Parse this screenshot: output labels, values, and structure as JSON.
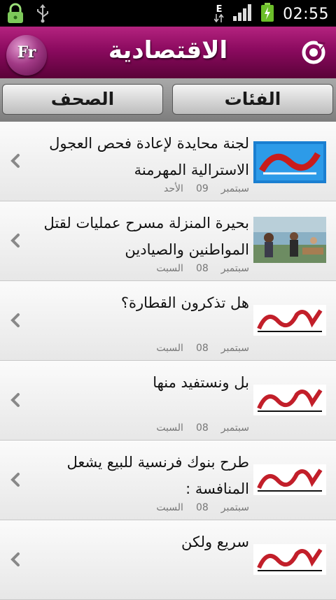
{
  "statusbar": {
    "clock": "02:55",
    "network_letter": "E",
    "icons": [
      "lock-icon",
      "usb-icon",
      "data-transfer-icon",
      "signal-icon",
      "battery-charging-icon"
    ]
  },
  "titlebar": {
    "logo_text": "Fr",
    "title": "الاقتصادية",
    "refresh_icon": "refresh-icon"
  },
  "tabs": {
    "papers": "الصحف",
    "categories": "الفئات"
  },
  "articles": [
    {
      "headline": "لجنة محايدة لإعادة فحص العجول الاسترالية المهرمنة",
      "day": "الأحد",
      "date": "09",
      "month": "سبتمبر",
      "source_icon": "akhbar-logo-icon"
    },
    {
      "headline": "بحيرة المنزلة مسرح عمليات لقتل المواطنين والصيادين",
      "day": "السبت",
      "date": "08",
      "month": "سبتمبر",
      "source_icon": "photo-thumbnail-icon"
    },
    {
      "headline": "هل تذكرون القطارة؟",
      "day": "السبت",
      "date": "08",
      "month": "سبتمبر",
      "source_icon": "ahram-logo-icon"
    },
    {
      "headline": "بل ونستفيد منها",
      "day": "السبت",
      "date": "08",
      "month": "سبتمبر",
      "source_icon": "ahram-logo-icon"
    },
    {
      "headline": "طرح بنوك فرنسية للبيع يشعل المنافسة :",
      "day": "السبت",
      "date": "08",
      "month": "سبتمبر",
      "source_icon": "ahram-logo-icon"
    },
    {
      "headline": "سريع ولكن",
      "day": "",
      "date": "",
      "month": "",
      "source_icon": "ahram-logo-icon"
    }
  ],
  "colors": {
    "titlebar": "#8b0a5f",
    "accent": "#b4237f"
  }
}
